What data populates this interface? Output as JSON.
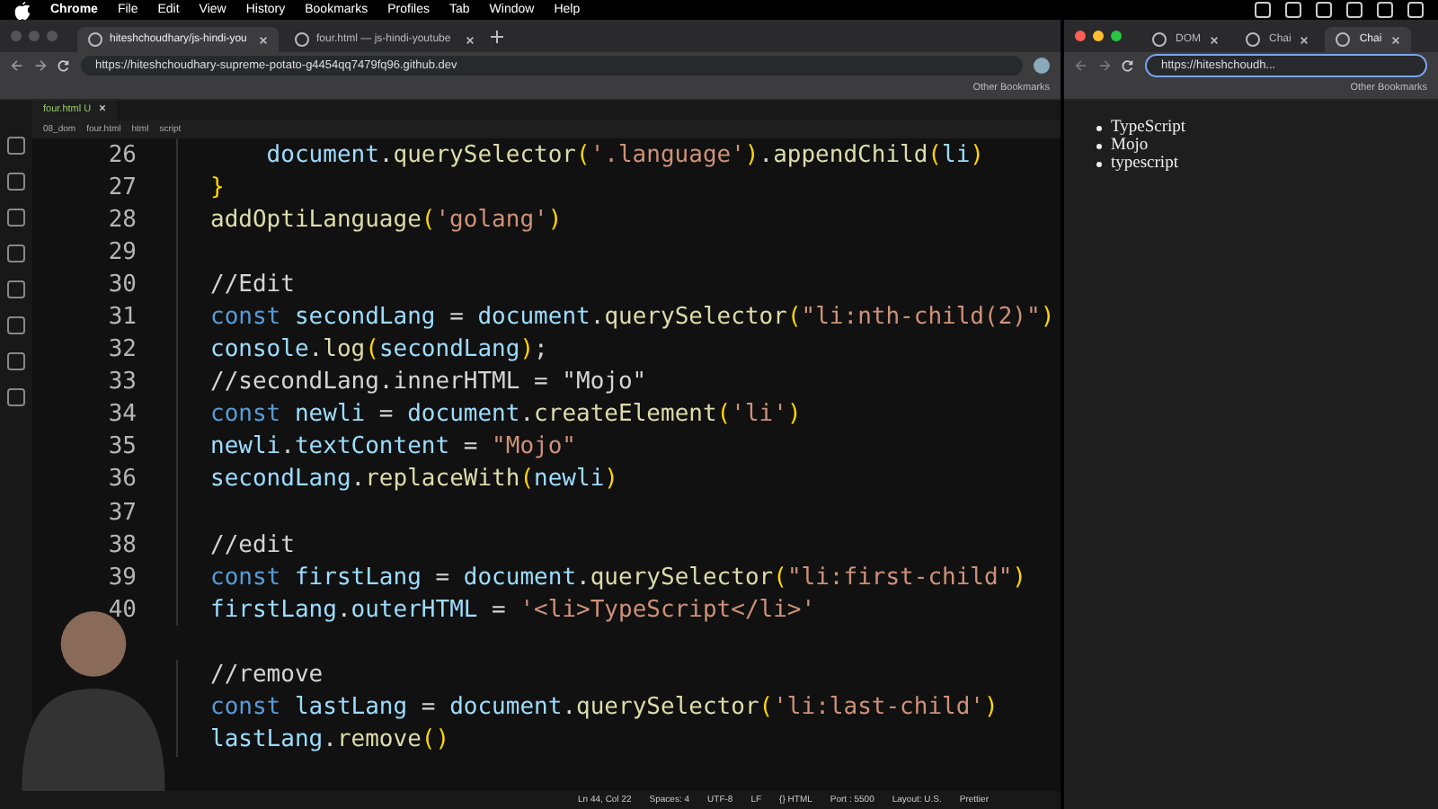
{
  "menu_bar": {
    "app": "Chrome",
    "items": [
      "File",
      "Edit",
      "View",
      "History",
      "Bookmarks",
      "Profiles",
      "Tab",
      "Window",
      "Help"
    ]
  },
  "left_browser": {
    "tabs": [
      {
        "label": "hiteshchoudhary/js-hindi-you",
        "selected": true
      },
      {
        "label": "four.html — js-hindi-youtube",
        "selected": false
      }
    ],
    "url": "https://hiteshchoudhary-supreme-potato-g4454qq7479fq96.github.dev",
    "bookmarks": "Other Bookmarks"
  },
  "editor": {
    "tab": {
      "label": "four.html",
      "badge": "U"
    },
    "breadcrumbs": [
      "08_dom",
      "four.html",
      "html",
      "script"
    ],
    "lines": [
      {
        "number": "26",
        "tokens": [
          {
            "t": "    document",
            "color": "#9cdcfe"
          },
          {
            "t": ".",
            "color": "#d4d4d4"
          },
          {
            "t": "querySelector",
            "color": "#dcdcaa"
          },
          {
            "t": "(",
            "color": "#ffd700"
          },
          {
            "t": "'.language'",
            "color": "#ce9178"
          },
          {
            "t": ")",
            "color": "#ffd700"
          },
          {
            "t": ".",
            "color": "#d4d4d4"
          },
          {
            "t": "appendChild",
            "color": "#dcdcaa"
          },
          {
            "t": "(",
            "color": "#ffd700"
          },
          {
            "t": "li",
            "color": "#9cdcfe"
          },
          {
            "t": ")",
            "color": "#ffd700"
          }
        ]
      },
      {
        "number": "27",
        "tokens": [
          {
            "t": "}",
            "color": "#ffd700"
          }
        ]
      },
      {
        "number": "28",
        "tokens": [
          {
            "t": "addOptiLanguage",
            "color": "#dcdcaa"
          },
          {
            "t": "(",
            "color": "#ffd700"
          },
          {
            "t": "'golang'",
            "color": "#ce9178"
          },
          {
            "t": ")",
            "color": "#ffd700"
          }
        ]
      },
      {
        "number": "29"
      },
      {
        "number": "30",
        "tokens": [
          {
            "t": "//Edit",
            "color": "#d4d4d4"
          }
        ]
      },
      {
        "number": "31",
        "tokens": [
          {
            "t": "const ",
            "color": "#569cd6"
          },
          {
            "t": "secondLang",
            "color": "#9cdcfe"
          },
          {
            "t": " = ",
            "color": "#d4d4d4"
          },
          {
            "t": "document",
            "color": "#9cdcfe"
          },
          {
            "t": ".",
            "color": "#d4d4d4"
          },
          {
            "t": "querySelector",
            "color": "#dcdcaa"
          },
          {
            "t": "(",
            "color": "#ffd700"
          },
          {
            "t": "\"li:nth-child(2)\"",
            "color": "#ce9178"
          },
          {
            "t": ")",
            "color": "#ffd700"
          }
        ]
      },
      {
        "number": "32",
        "tokens": [
          {
            "t": "console",
            "color": "#9cdcfe"
          },
          {
            "t": ".",
            "color": "#d4d4d4"
          },
          {
            "t": "log",
            "color": "#dcdcaa"
          },
          {
            "t": "(",
            "color": "#ffd700"
          },
          {
            "t": "secondLang",
            "color": "#9cdcfe"
          },
          {
            "t": ")",
            "color": "#ffd700"
          },
          {
            "t": ";",
            "color": "#d4d4d4"
          }
        ]
      },
      {
        "number": "33",
        "tokens": [
          {
            "t": "//secondLang.innerHTML = \"Mojo\"",
            "color": "#d4d4d4"
          }
        ]
      },
      {
        "number": "34",
        "tokens": [
          {
            "t": "const ",
            "color": "#569cd6"
          },
          {
            "t": "newli",
            "color": "#9cdcfe"
          },
          {
            "t": " = ",
            "color": "#d4d4d4"
          },
          {
            "t": "document",
            "color": "#9cdcfe"
          },
          {
            "t": ".",
            "color": "#d4d4d4"
          },
          {
            "t": "createElement",
            "color": "#dcdcaa"
          },
          {
            "t": "(",
            "color": "#ffd700"
          },
          {
            "t": "'li'",
            "color": "#ce9178"
          },
          {
            "t": ")",
            "color": "#ffd700"
          }
        ]
      },
      {
        "number": "35",
        "tokens": [
          {
            "t": "newli",
            "color": "#9cdcfe"
          },
          {
            "t": ".",
            "color": "#d4d4d4"
          },
          {
            "t": "textContent",
            "color": "#9cdcfe"
          },
          {
            "t": " = ",
            "color": "#d4d4d4"
          },
          {
            "t": "\"Mojo\"",
            "color": "#ce9178"
          }
        ]
      },
      {
        "number": "36",
        "tokens": [
          {
            "t": "secondLang",
            "color": "#9cdcfe"
          },
          {
            "t": ".",
            "color": "#d4d4d4"
          },
          {
            "t": "replaceWith",
            "color": "#dcdcaa"
          },
          {
            "t": "(",
            "color": "#ffd700"
          },
          {
            "t": "newli",
            "color": "#9cdcfe"
          },
          {
            "t": ")",
            "color": "#ffd700"
          }
        ]
      },
      {
        "number": "37"
      },
      {
        "number": "38",
        "tokens": [
          {
            "t": "//edit",
            "color": "#d4d4d4"
          }
        ]
      },
      {
        "number": "39",
        "tokens": [
          {
            "t": "const ",
            "color": "#569cd6"
          },
          {
            "t": "firstLang",
            "color": "#9cdcfe"
          },
          {
            "t": " = ",
            "color": "#d4d4d4"
          },
          {
            "t": "document",
            "color": "#9cdcfe"
          },
          {
            "t": ".",
            "color": "#d4d4d4"
          },
          {
            "t": "querySelector",
            "color": "#dcdcaa"
          },
          {
            "t": "(",
            "color": "#ffd700"
          },
          {
            "t": "\"li:first-child\"",
            "color": "#ce9178"
          },
          {
            "t": ")",
            "color": "#ffd700"
          }
        ]
      },
      {
        "number": "40",
        "tokens": [
          {
            "t": "firstLang",
            "color": "#9cdcfe"
          },
          {
            "t": ".",
            "color": "#d4d4d4"
          },
          {
            "t": "outerHTML",
            "color": "#9cdcfe"
          },
          {
            "t": " = ",
            "color": "#d4d4d4"
          },
          {
            "t": "'<li>TypeScript</li>'",
            "color": "#ce9178"
          }
        ]
      },
      {
        "tokens": [
          {
            "t": "//remove",
            "color": "#d4d4d4"
          }
        ]
      },
      {
        "tokens": [
          {
            "t": "const ",
            "color": "#569cd6"
          },
          {
            "t": "lastLang",
            "color": "#9cdcfe"
          },
          {
            "t": " = ",
            "color": "#d4d4d4"
          },
          {
            "t": "document",
            "color": "#9cdcfe"
          },
          {
            "t": ".",
            "color": "#d4d4d4"
          },
          {
            "t": "querySelector",
            "color": "#dcdcaa"
          },
          {
            "t": "(",
            "color": "#ffd700"
          },
          {
            "t": "'li:last-child'",
            "color": "#ce9178"
          },
          {
            "t": ")",
            "color": "#ffd700"
          }
        ]
      },
      {
        "tokens": [
          {
            "t": "lastLang",
            "color": "#9cdcfe"
          },
          {
            "t": ".",
            "color": "#d4d4d4"
          },
          {
            "t": "remove",
            "color": "#dcdcaa"
          },
          {
            "t": "()",
            "color": "#ffd700"
          }
        ]
      }
    ]
  },
  "status_bar": [
    "Ln 44, Col 22",
    "Spaces: 4",
    "UTF-8",
    "LF",
    "{} HTML",
    "Port : 5500",
    "Layout: U.S.",
    "Prettier"
  ],
  "right_browser": {
    "tabs": [
      {
        "label": "DOM",
        "selected": false
      },
      {
        "label": "Chai",
        "selected": false
      },
      {
        "label": "Chai",
        "selected": true
      }
    ],
    "url": "https://hiteshchoudh...",
    "bookmarks": "Other Bookmarks",
    "list": [
      "TypeScript",
      "Mojo",
      "typescript"
    ]
  }
}
